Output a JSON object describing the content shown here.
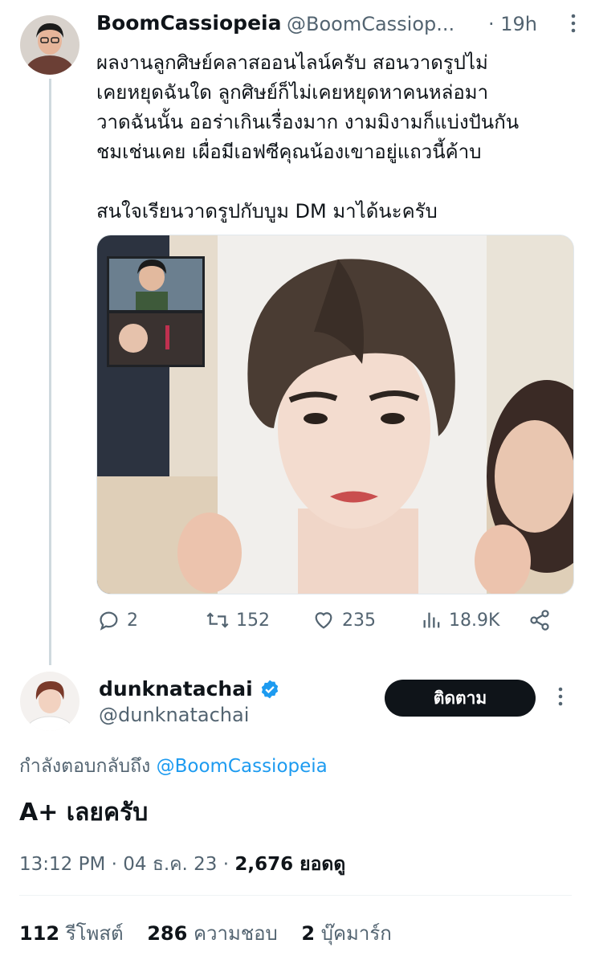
{
  "tweet": {
    "display_name": "BoomCassiopeia",
    "handle": "@BoomCassiop...",
    "time": "· 19h",
    "lines": [
      "ผลงานลูกศิษย์คลาสออนไลน์ครับ สอนวาดรูปไม่",
      "เคยหยุดฉันใด ลูกศิษย์ก็ไม่เคยหยุดหาคนหล่อมา",
      "วาดฉันนั้น ออร่าเกินเรื่องมาก งามมิงามก็แบ่งปันกัน",
      "ชมเช่นเคย เผื่อมีเอฟซีคุณน้องเขาอยู่แถวนี้ค้าบ"
    ],
    "line_last": "สนใจเรียนวาดรูปกับบูม DM มาได้นะครับ",
    "actions": {
      "reply_count": "2",
      "retweet_count": "152",
      "like_count": "235",
      "views_count": "18.9K"
    }
  },
  "reply": {
    "display_name": "dunknatachai",
    "handle": "@dunknatachai",
    "follow_label": "ติดตาม",
    "replying_prefix": "กำลังตอบกลับถึง",
    "replying_to": "@BoomCassiopeia",
    "text": "A+ เลยครับ",
    "time": "13:12 PM · 04 ธ.ค. 23 · ",
    "views_value": "2,676 ยอดดู",
    "stats": {
      "retweets_num": "112",
      "retweets_label": "รีโพสต์",
      "likes_num": "286",
      "likes_label": "ความชอบ",
      "bookmarks_num": "2",
      "bookmarks_label": "บุ๊คมาร์ก"
    }
  },
  "colors": {
    "accent": "#1d9bf0",
    "muted": "#536471",
    "text": "#0f1419",
    "button_bg": "#0f1419"
  }
}
